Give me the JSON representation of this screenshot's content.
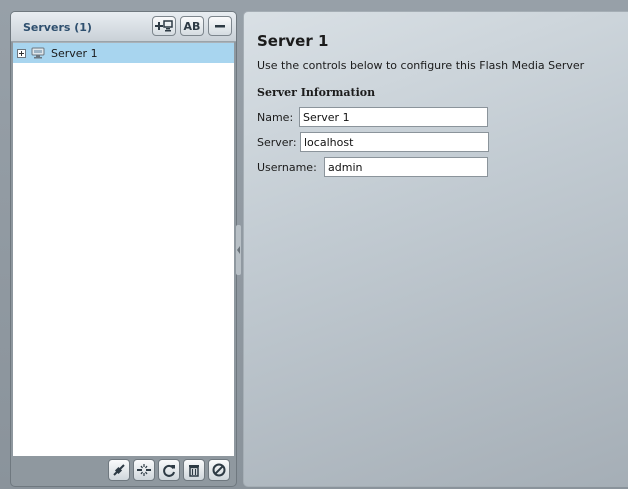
{
  "servers_panel": {
    "title": "Servers (1)",
    "header_buttons": [
      {
        "icon": "add-server-icon"
      },
      {
        "icon": "rename-icon",
        "label": "AB"
      },
      {
        "icon": "minus-icon"
      }
    ],
    "tree": [
      {
        "label": "Server 1",
        "icon": "server-icon",
        "selected": true,
        "expanded": false
      }
    ],
    "footer_buttons": [
      {
        "icon": "connect-icon"
      },
      {
        "icon": "disconnect-icon"
      },
      {
        "icon": "refresh-icon"
      },
      {
        "icon": "delete-icon"
      },
      {
        "icon": "cancel-icon"
      }
    ]
  },
  "main": {
    "title": "Server 1",
    "subtitle": "Use the controls below to configure this Flash Media Server",
    "section_heading": "Server Information",
    "fields": {
      "name": {
        "label": "Name:",
        "value": "Server 1"
      },
      "server": {
        "label": "Server:",
        "value": "localhost"
      },
      "username": {
        "label": "Username:",
        "value": "admin"
      }
    }
  },
  "colors": {
    "selection": "#a8d5ef",
    "panel_title": "#2e4f6e"
  }
}
